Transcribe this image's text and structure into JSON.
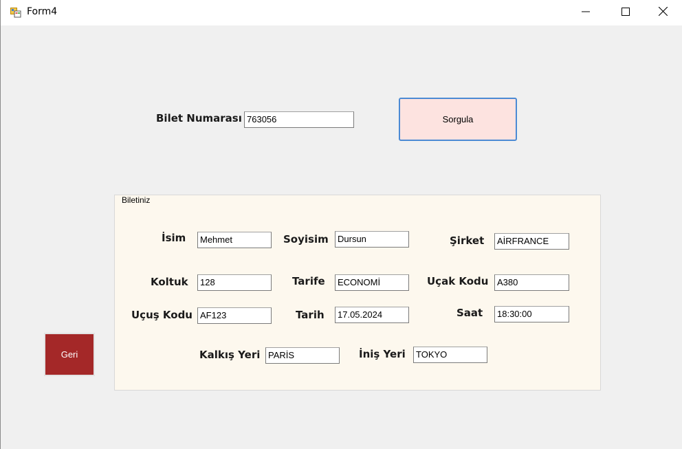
{
  "window": {
    "title": "Form4"
  },
  "search": {
    "label": "Bilet Numarası",
    "value": "763056",
    "button_label": "Sorgula"
  },
  "ticket": {
    "group_title": "Biletiniz",
    "isim_label": "İsim",
    "isim_value": "Mehmet",
    "soyisim_label": "Soyisim",
    "soyisim_value": "Dursun",
    "sirket_label": "Şirket",
    "sirket_value": "AİRFRANCE",
    "koltuk_label": "Koltuk",
    "koltuk_value": "128",
    "tarife_label": "Tarife",
    "tarife_value": "ECONOMİ",
    "ucak_kodu_label": "Uçak Kodu",
    "ucak_kodu_value": "A380",
    "ucus_kodu_label": "Uçuş Kodu",
    "ucus_kodu_value": "AF123",
    "tarih_label": "Tarih",
    "tarih_value": "17.05.2024",
    "saat_label": "Saat",
    "saat_value": "18:30:00",
    "kalkis_label": "Kalkış Yeri",
    "kalkis_value": "PARİS",
    "inis_label": "İniş Yeri",
    "inis_value": "TOKYO"
  },
  "back_button": {
    "label": "Geri"
  },
  "colors": {
    "sorgula_bg": "#fde3e0",
    "geri_bg": "#a42828",
    "group_bg": "#fdf8ee",
    "focus_border": "#4b8ad4"
  },
  "icons": {
    "app": "winforms-app-icon",
    "minimize": "minimize-icon",
    "maximize": "maximize-icon",
    "close": "close-icon"
  }
}
